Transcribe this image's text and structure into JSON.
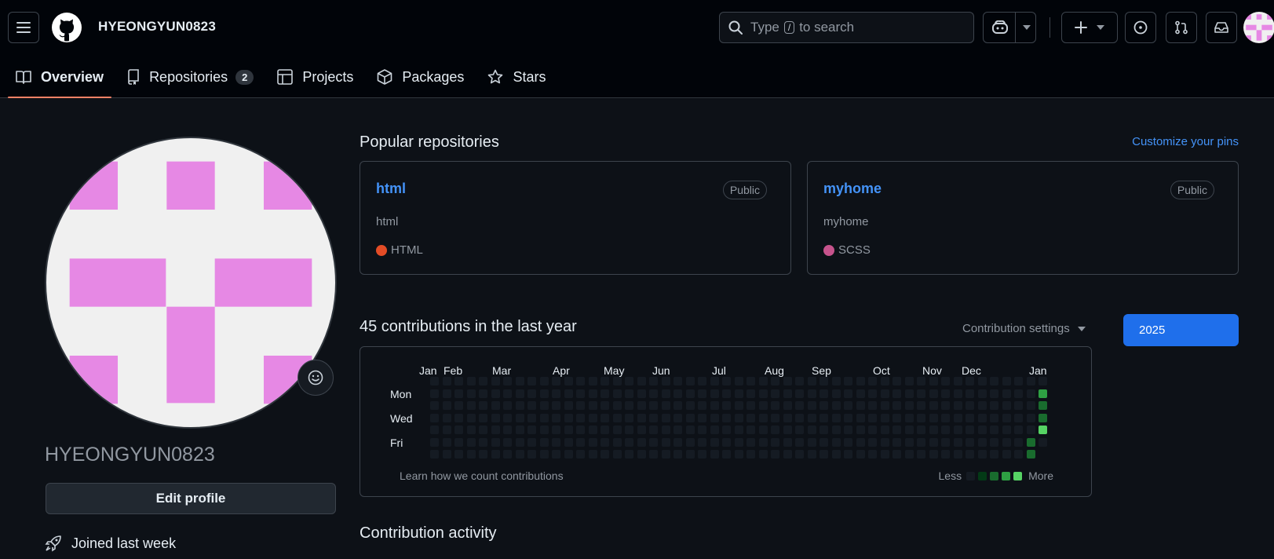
{
  "header": {
    "username": "HYEONGYUN0823",
    "search_prefix": "Type",
    "search_key": "/",
    "search_suffix": "to search"
  },
  "nav": {
    "tabs": [
      {
        "label": "Overview",
        "icon": "book-icon",
        "active": true
      },
      {
        "label": "Repositories",
        "icon": "repo-icon",
        "count": "2"
      },
      {
        "label": "Projects",
        "icon": "table-icon"
      },
      {
        "label": "Packages",
        "icon": "package-icon"
      },
      {
        "label": "Stars",
        "icon": "star-icon"
      }
    ]
  },
  "profile": {
    "login": "HYEONGYUN0823",
    "edit_label": "Edit profile",
    "joined": "Joined last week"
  },
  "popular": {
    "title": "Popular repositories",
    "customize": "Customize your pins",
    "repos": [
      {
        "name": "html",
        "visibility": "Public",
        "description": "html",
        "language": "HTML",
        "lang_color": "#e34c26"
      },
      {
        "name": "myhome",
        "visibility": "Public",
        "description": "myhome",
        "language": "SCSS",
        "lang_color": "#c6538c"
      }
    ]
  },
  "contributions": {
    "title": "45 contributions in the last year",
    "settings": "Contribution settings",
    "year": "2025",
    "months": [
      "Jan",
      "Feb",
      "Mar",
      "Apr",
      "May",
      "Jun",
      "Jul",
      "Aug",
      "Sep",
      "Oct",
      "Nov",
      "Dec",
      "Jan"
    ],
    "days": [
      "Mon",
      "Wed",
      "Fri"
    ],
    "learn": "Learn how we count contributions",
    "less": "Less",
    "more": "More",
    "levels": [
      "#151b23",
      "#033a16",
      "#196c2e",
      "#2ea043",
      "#56d364"
    ],
    "recent_levels": {
      "prev_week": [
        0,
        0,
        0,
        0,
        0,
        2,
        2,
        0
      ],
      "last_week": [
        0,
        3,
        2,
        2,
        4,
        0,
        0
      ]
    }
  },
  "activity": {
    "title": "Contribution activity"
  }
}
